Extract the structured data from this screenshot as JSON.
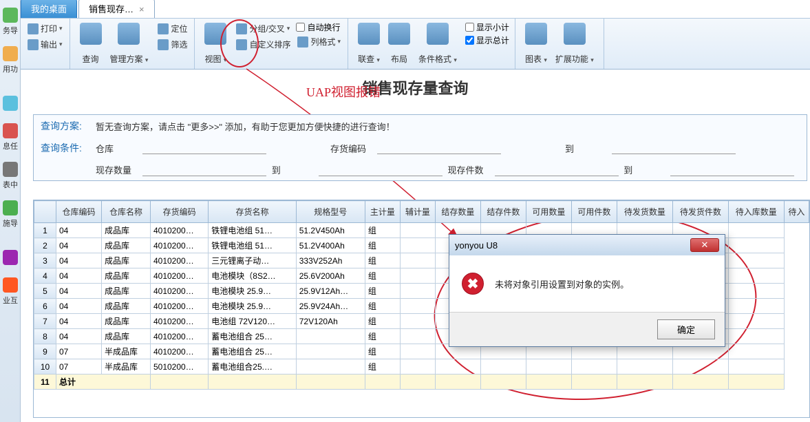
{
  "sidebar": {
    "items": [
      {
        "label": "务导"
      },
      {
        "label": "用功"
      },
      {
        "label": ""
      },
      {
        "label": "息任"
      },
      {
        "label": "表中"
      },
      {
        "label": "施导"
      },
      {
        "label": ""
      },
      {
        "label": "业互"
      }
    ]
  },
  "tabs": [
    {
      "label": "我的桌面",
      "closable": false
    },
    {
      "label": "销售现存…",
      "closable": true
    }
  ],
  "ribbon": {
    "print": "打印",
    "export": "输出",
    "query": "查询",
    "scheme": "管理方案",
    "locate": "定位",
    "filter": "筛选",
    "view": "视图",
    "group": "分组/交叉",
    "sort": "自定义排序",
    "autowrap": "自动换行",
    "colstyle": "列格式",
    "linkq": "联查",
    "layout": "布局",
    "condfmt": "条件格式",
    "subtotal": "显示小计",
    "grandtotal": "显示总计",
    "chart": "图表",
    "ext": "扩展功能"
  },
  "annotation": "UAP视图报错",
  "page_title": "销售现存量查询",
  "query": {
    "scheme_label": "查询方案:",
    "scheme_text": "暂无查询方案，请点击 \"更多>>\" 添加，有助于您更加方便快捷的进行查询！",
    "cond_label": "查询条件:",
    "fields": {
      "warehouse": "仓库",
      "inv_code": "存货编码",
      "to1": "到",
      "qty": "现存数量",
      "to2": "到",
      "pieces": "现存件数",
      "to3": "到"
    }
  },
  "grid": {
    "columns": [
      "仓库编码",
      "仓库名称",
      "存货编码",
      "存货名称",
      "规格型号",
      "主计量",
      "辅计量",
      "结存数量",
      "结存件数",
      "可用数量",
      "可用件数",
      "待发货数量",
      "待发货件数",
      "待入库数量",
      "待入"
    ],
    "rows": [
      {
        "n": "1",
        "wc": "04",
        "wn": "成品库",
        "ic": "4010200…",
        "in": "铁锂电池组 51…",
        "spec": "51.2V450Ah",
        "uom": "组"
      },
      {
        "n": "2",
        "wc": "04",
        "wn": "成品库",
        "ic": "4010200…",
        "in": "铁锂电池组 51…",
        "spec": "51.2V400Ah",
        "uom": "组"
      },
      {
        "n": "3",
        "wc": "04",
        "wn": "成品库",
        "ic": "4010200…",
        "in": "三元锂离子动…",
        "spec": "333V252Ah",
        "uom": "组"
      },
      {
        "n": "4",
        "wc": "04",
        "wn": "成品库",
        "ic": "4010200…",
        "in": "电池模块（8S2…",
        "spec": "25.6V200Ah",
        "uom": "组"
      },
      {
        "n": "5",
        "wc": "04",
        "wn": "成品库",
        "ic": "4010200…",
        "in": "电池模块 25.9…",
        "spec": "25.9V12Ah…",
        "uom": "组"
      },
      {
        "n": "6",
        "wc": "04",
        "wn": "成品库",
        "ic": "4010200…",
        "in": "电池模块 25.9…",
        "spec": "25.9V24Ah…",
        "uom": "组"
      },
      {
        "n": "7",
        "wc": "04",
        "wn": "成品库",
        "ic": "4010200…",
        "in": "电池组 72V120…",
        "spec": "72V120Ah",
        "uom": "组"
      },
      {
        "n": "8",
        "wc": "04",
        "wn": "成品库",
        "ic": "4010200…",
        "in": "蓄电池组合 25…",
        "spec": "",
        "uom": "组"
      },
      {
        "n": "9",
        "wc": "07",
        "wn": "半成品库",
        "ic": "4010200…",
        "in": "蓄电池组合 25…",
        "spec": "",
        "uom": "组"
      },
      {
        "n": "10",
        "wc": "07",
        "wn": "半成品库",
        "ic": "5010200…",
        "in": "蓄电池组合25.…",
        "spec": "",
        "uom": "组"
      }
    ],
    "total_label": "总计",
    "total_n": "11"
  },
  "dialog": {
    "title": "yonyou U8",
    "message": "未将对象引用设置到对象的实例。",
    "ok": "确定"
  }
}
